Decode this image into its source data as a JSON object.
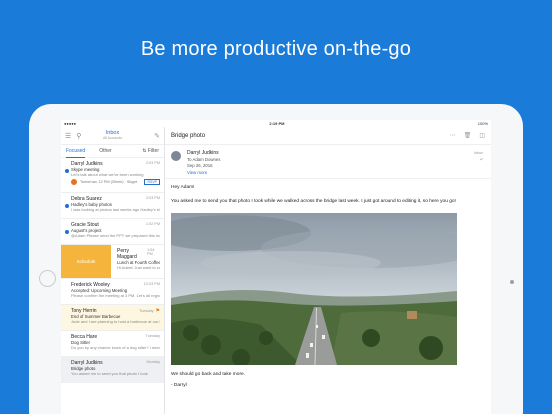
{
  "headline": "Be more productive on-the-go",
  "status": {
    "time": "2:19 PM",
    "battery": "100%"
  },
  "list": {
    "title": "Inbox",
    "subtitle": "All Accounts",
    "tabs": [
      "Focused",
      "Other"
    ],
    "filter_label": "Filter",
    "messages": [
      {
        "from": "Darryl Judkins",
        "time": "2:03 PM",
        "subject": "Skype meeting",
        "preview": "Let's talk about what we've been working",
        "event": "Tomorrow, 12 PM (30min) · Skype",
        "rsvp": "RSVP",
        "unread": true
      },
      {
        "from": "Debra Suarez",
        "time": "2:03 PM",
        "subject": "Hadley's baby photos",
        "preview": "I was looking at photos last weeks ago Hadley's birthday party! I wanted to share the",
        "unread": true
      },
      {
        "from": "Gracie Stout",
        "time": "1:02 PM",
        "subject": "August's project",
        "preview": "@Adam Please send the PPT we prepared this morning. I'd like to",
        "unread": true
      },
      {
        "from": "Perry Maggard",
        "time": "1:54 PM",
        "subject": "Lunch at Fourth Coffee",
        "preview": "Hi Adam! Just want to confirm that you'll make it to this invite",
        "swipe_label": "Schedule",
        "unread": false
      },
      {
        "from": "Frederick Wooley",
        "time": "12:03 PM",
        "subject": "Accepted: Upcoming Meeting",
        "preview": "Please confirm the meeting at 3 PM. Let's all regroup to ensure",
        "unread": false
      },
      {
        "from": "Tony Herrin",
        "time": "Tuesday",
        "subject": "End of Summer Barbecue",
        "preview": "Jude and I are planning to host a barbecue at our house mid-September",
        "flagged": true,
        "unread": false
      },
      {
        "from": "Becca Hare",
        "time": "Tuesday",
        "subject": "Dog Sitter",
        "preview": "Do you by any chance know of a dog sitter? I need someone to watch",
        "unread": false
      },
      {
        "from": "Darryl Judkins",
        "time": "Monday",
        "subject": "Bridge photo",
        "preview": "You asked me to send you that photo I took",
        "unread": false
      }
    ]
  },
  "reader": {
    "title": "Bridge photo",
    "sender": "Darryl Judkins",
    "to": "To Adam Downes",
    "date": "Sep 26, 2016",
    "view_more": "View more",
    "folder": "Inbox",
    "greeting": "Hey Adam!",
    "body": "You asked me to send you that photo I took while we walked across the bridge last week. I just got around to editing it, so here you go!",
    "closing1": "We should go back and take more.",
    "signoff": "- Darryl"
  },
  "colors": {
    "brand": "#1a7bd8",
    "accent": "#1f6fd1",
    "schedule": "#f5b53d"
  }
}
